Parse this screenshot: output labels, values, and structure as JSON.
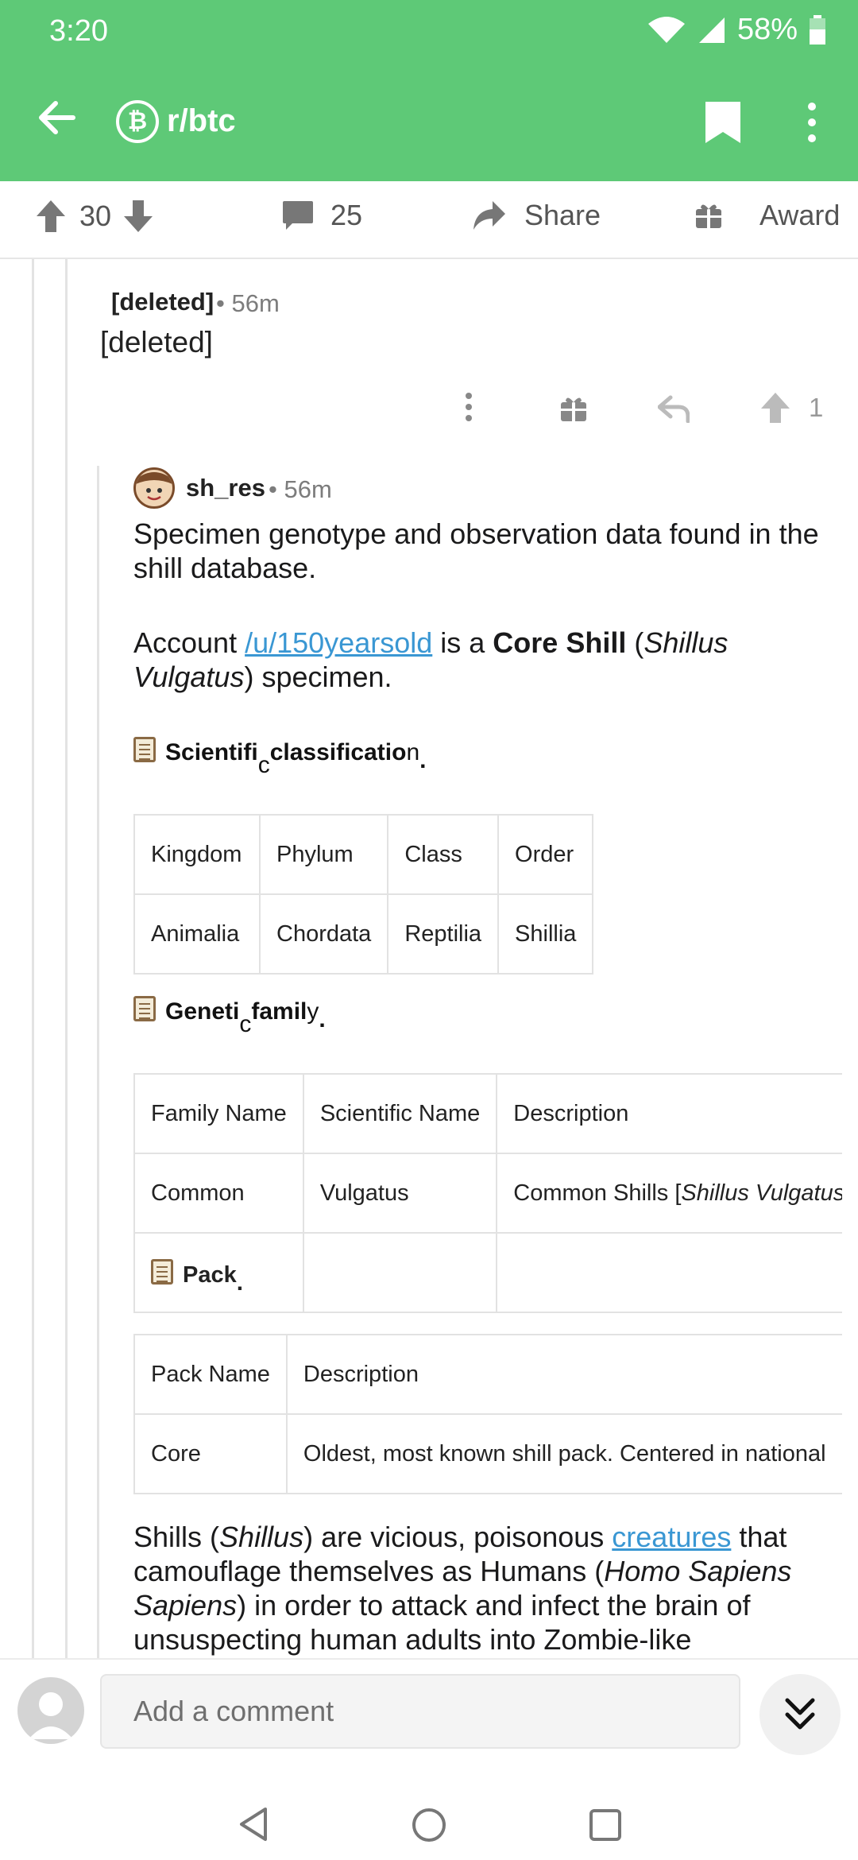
{
  "status_bar": {
    "time": "3:20",
    "battery": "58%"
  },
  "app_bar": {
    "subreddit": "r/btc",
    "subreddit_icon": "₿"
  },
  "post_actions": {
    "score": "30",
    "comments": "25",
    "share": "Share",
    "award": "Award"
  },
  "comment_deleted": {
    "author": "[deleted]",
    "age": "• 56m",
    "body": "[deleted]",
    "score": "1"
  },
  "comment_reply": {
    "author": "sh_res",
    "age": "• 56m",
    "p1": "Specimen genotype and observation data found in the shill database.",
    "p2_pre": "Account ",
    "p2_link": "/u/150yearsold",
    "p2_mid": " is a ",
    "p2_bold": "Core Shill",
    "p2_paren_open": " (",
    "p2_italic": "Shillus Vulgatus",
    "p2_post": ") specimen.",
    "h_classification": {
      "a": "Scientifi",
      "b": "c",
      "c": " classificatio",
      "d": "n",
      "e": "."
    },
    "classification_table": {
      "headers": [
        "Kingdom",
        "Phylum",
        "Class",
        "Order"
      ],
      "row": [
        "Animalia",
        "Chordata",
        "Reptilia",
        "Shillia"
      ]
    },
    "h_family": {
      "a": "Geneti",
      "b": "c",
      "c": " famil",
      "d": "y",
      "e": "."
    },
    "family_table": {
      "headers": [
        "Family Name",
        "Scientific Name",
        "Description"
      ],
      "row": [
        "Common",
        "Vulgatus",
        "Common Shills ["
      ],
      "row_desc_italic": "Shillus Vulgatus",
      "pack_label": "Pack",
      "pack_dot": "."
    },
    "pack_table": {
      "headers": [
        "Pack Name",
        "Description"
      ],
      "row": [
        "Core",
        "Oldest, most known shill pack. Centered in national"
      ]
    },
    "p3_pre": "Shills (",
    "p3_italic1": "Shillus",
    "p3_mid1": ") are vicious, poisonous ",
    "p3_link": "creatures",
    "p3_mid2": " that camouflage themselves as Humans (",
    "p3_italic2": "Homo Sapiens Sapiens",
    "p3_post": ") in order to attack and infect the brain of unsuspecting human adults into Zombie-like"
  },
  "composer": {
    "placeholder": "Add a comment"
  }
}
